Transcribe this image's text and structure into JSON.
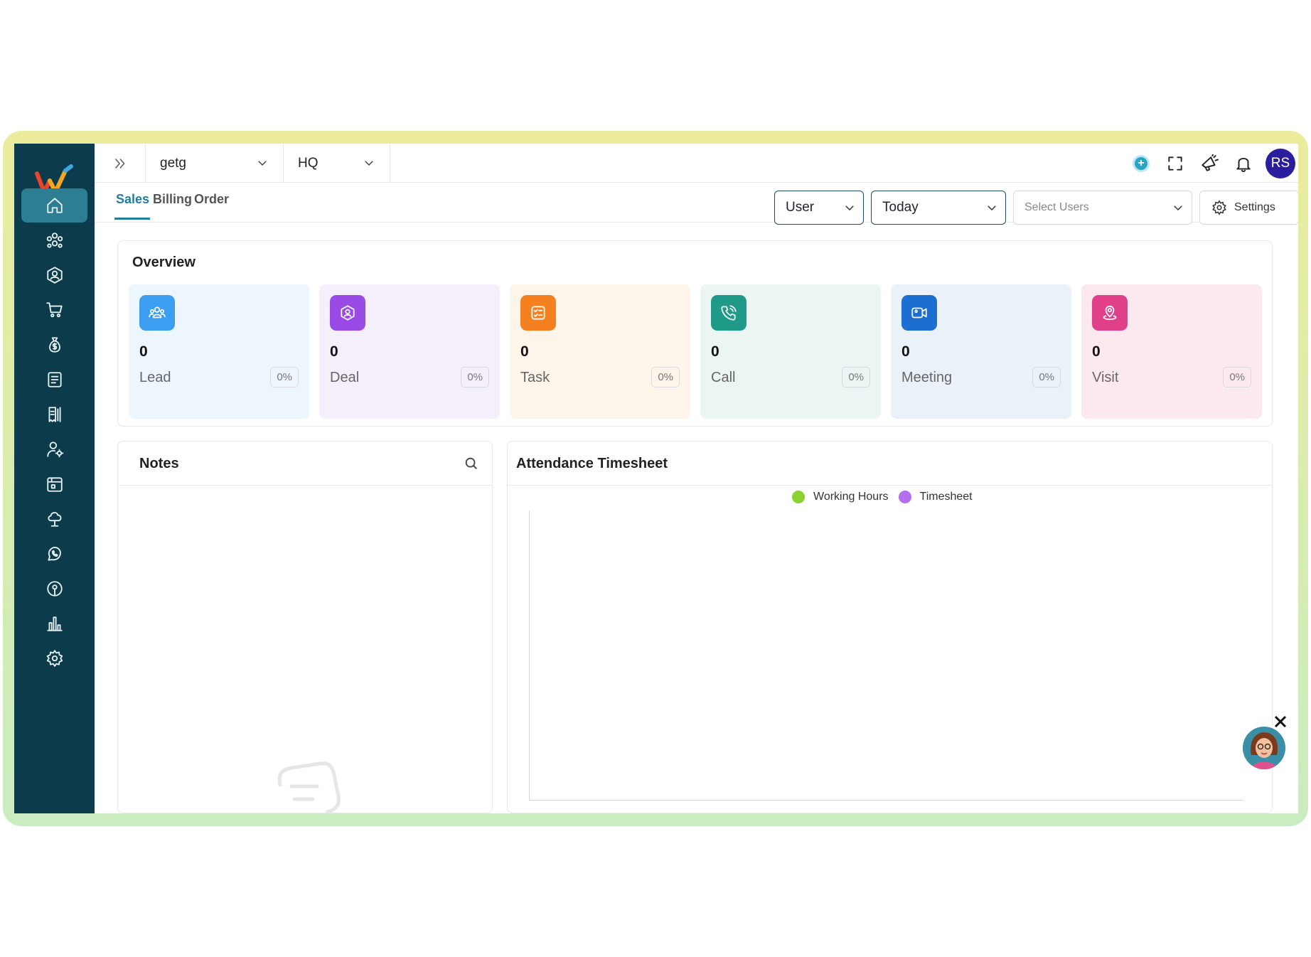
{
  "topbar": {
    "company_select": "getg",
    "branch_select": "HQ",
    "avatar_initials": "RS"
  },
  "subbar": {
    "tabs": [
      {
        "label": "Sales",
        "active": true
      },
      {
        "label": "Billing",
        "active": false
      },
      {
        "label": "Order",
        "active": false
      }
    ],
    "view_select": "User",
    "period_select": "Today",
    "users_placeholder": "Select Users",
    "settings_label": "Settings"
  },
  "overview": {
    "title": "Overview",
    "cards": [
      {
        "label": "Lead",
        "value": "0",
        "percent": "0%",
        "icon": "users-icon",
        "bg": "#edf5fd",
        "icon_bg": "#3b9ef0"
      },
      {
        "label": "Deal",
        "value": "0",
        "percent": "0%",
        "icon": "deal-icon",
        "bg": "#f5effc",
        "icon_bg": "#9a4be6"
      },
      {
        "label": "Task",
        "value": "0",
        "percent": "0%",
        "icon": "task-icon",
        "bg": "#fdf4ea",
        "icon_bg": "#f4801f"
      },
      {
        "label": "Call",
        "value": "0",
        "percent": "0%",
        "icon": "phone-icon",
        "bg": "#ebf5f3",
        "icon_bg": "#1f9a88"
      },
      {
        "label": "Meeting",
        "value": "0",
        "percent": "0%",
        "icon": "video-icon",
        "bg": "#eaf1f8",
        "icon_bg": "#1c6fd0"
      },
      {
        "label": "Visit",
        "value": "0",
        "percent": "0%",
        "icon": "location-icon",
        "bg": "#fce9ef",
        "icon_bg": "#e0408a"
      }
    ]
  },
  "notes": {
    "title": "Notes"
  },
  "attendance": {
    "title": "Attendance Timesheet",
    "legend": [
      {
        "name": "Working Hours",
        "color": "#8bd12f"
      },
      {
        "name": "Timesheet",
        "color": "#b56ef0"
      }
    ]
  },
  "colors": {
    "sidebar": "#0c3b4c",
    "sidebar_active": "#2d7d93",
    "accent": "#1f7f9a"
  }
}
